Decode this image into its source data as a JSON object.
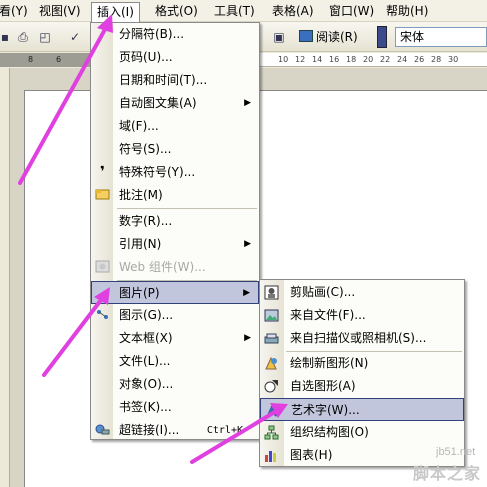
{
  "menubar": {
    "items": [
      {
        "label": "看(Y)"
      },
      {
        "label": "视图(V)"
      },
      {
        "label": "插入(I)"
      },
      {
        "label": "格式(O)"
      },
      {
        "label": "工具(T)"
      },
      {
        "label": "表格(A)"
      },
      {
        "label": "窗口(W)"
      },
      {
        "label": "帮助(H)"
      }
    ]
  },
  "toolbar": {
    "read_label": "阅读(R)",
    "font_name": "宋体"
  },
  "ruler": {
    "ticks": [
      "8",
      "6",
      "10",
      "12",
      "14",
      "16",
      "18",
      "20",
      "22",
      "24",
      "26",
      "28",
      "30"
    ]
  },
  "insert_menu": {
    "items": [
      {
        "label": "分隔符(B)..."
      },
      {
        "label": "页码(U)..."
      },
      {
        "label": "日期和时间(T)..."
      },
      {
        "label": "自动图文集(A)"
      },
      {
        "label": "域(F)..."
      },
      {
        "label": "符号(S)..."
      },
      {
        "label": "特殊符号(Y)..."
      },
      {
        "label": "批注(M)"
      },
      {
        "label": "数字(R)..."
      },
      {
        "label": "引用(N)"
      },
      {
        "label": "Web 组件(W)..."
      },
      {
        "label": "图片(P)"
      },
      {
        "label": "图示(G)..."
      },
      {
        "label": "文本框(X)"
      },
      {
        "label": "文件(L)..."
      },
      {
        "label": "对象(O)..."
      },
      {
        "label": "书签(K)..."
      },
      {
        "label": "超链接(I)...",
        "shortcut": "Ctrl+K"
      }
    ]
  },
  "picture_submenu": {
    "items": [
      {
        "label": "剪贴画(C)..."
      },
      {
        "label": "来自文件(F)..."
      },
      {
        "label": "来自扫描仪或照相机(S)..."
      },
      {
        "label": "绘制新图形(N)"
      },
      {
        "label": "自选图形(A)"
      },
      {
        "label": "艺术字(W)..."
      },
      {
        "label": "组织结构图(O)"
      },
      {
        "label": "图表(H)"
      }
    ]
  },
  "watermark": {
    "site": "jb51.net",
    "name": "脚本之家"
  },
  "colors": {
    "highlight": "#c1c6dc",
    "highlight_border": "#31417b",
    "arrow": "#e040e0"
  }
}
